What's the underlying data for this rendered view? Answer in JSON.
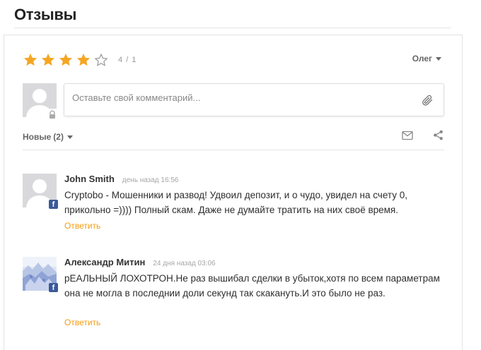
{
  "page": {
    "title": "Отзывы"
  },
  "rating": {
    "value": 4,
    "max": 5,
    "count_text": "4 / 1",
    "star_color": "#f5a623",
    "star_empty_color": "#9e9e9e"
  },
  "user_menu": {
    "name": "Олег"
  },
  "composer": {
    "placeholder": "Оставьте свой комментарий..."
  },
  "sort": {
    "label": "Новые",
    "count": "(2)"
  },
  "icons": {
    "attach": "paperclip-icon",
    "email": "envelope-icon",
    "share": "share-icon",
    "facebook": "facebook-icon",
    "lock": "lock-icon"
  },
  "colors": {
    "accent": "#f39c12",
    "facebook": "#3b5998"
  },
  "comments": [
    {
      "author": "John Smith",
      "time": "день назад 16:56",
      "text": "Cryptobo - Мошенники и развод! Удвоил депозит, и о чудо, увидел на счету 0, прикольно =))))  Полный скам. Даже не думайте тратить на них своё время.",
      "reply": "Ответить"
    },
    {
      "author": "Александр Митин",
      "time": "24 дня назад 03:06",
      "text": "рЕАЛЬНЫЙ ЛОХОТРОН.Не раз вышибал сделки в убыток,хотя по всем параметрам она не могла в последнии доли секунд так скакануть.И это было не раз.",
      "reply": "Ответить"
    }
  ]
}
